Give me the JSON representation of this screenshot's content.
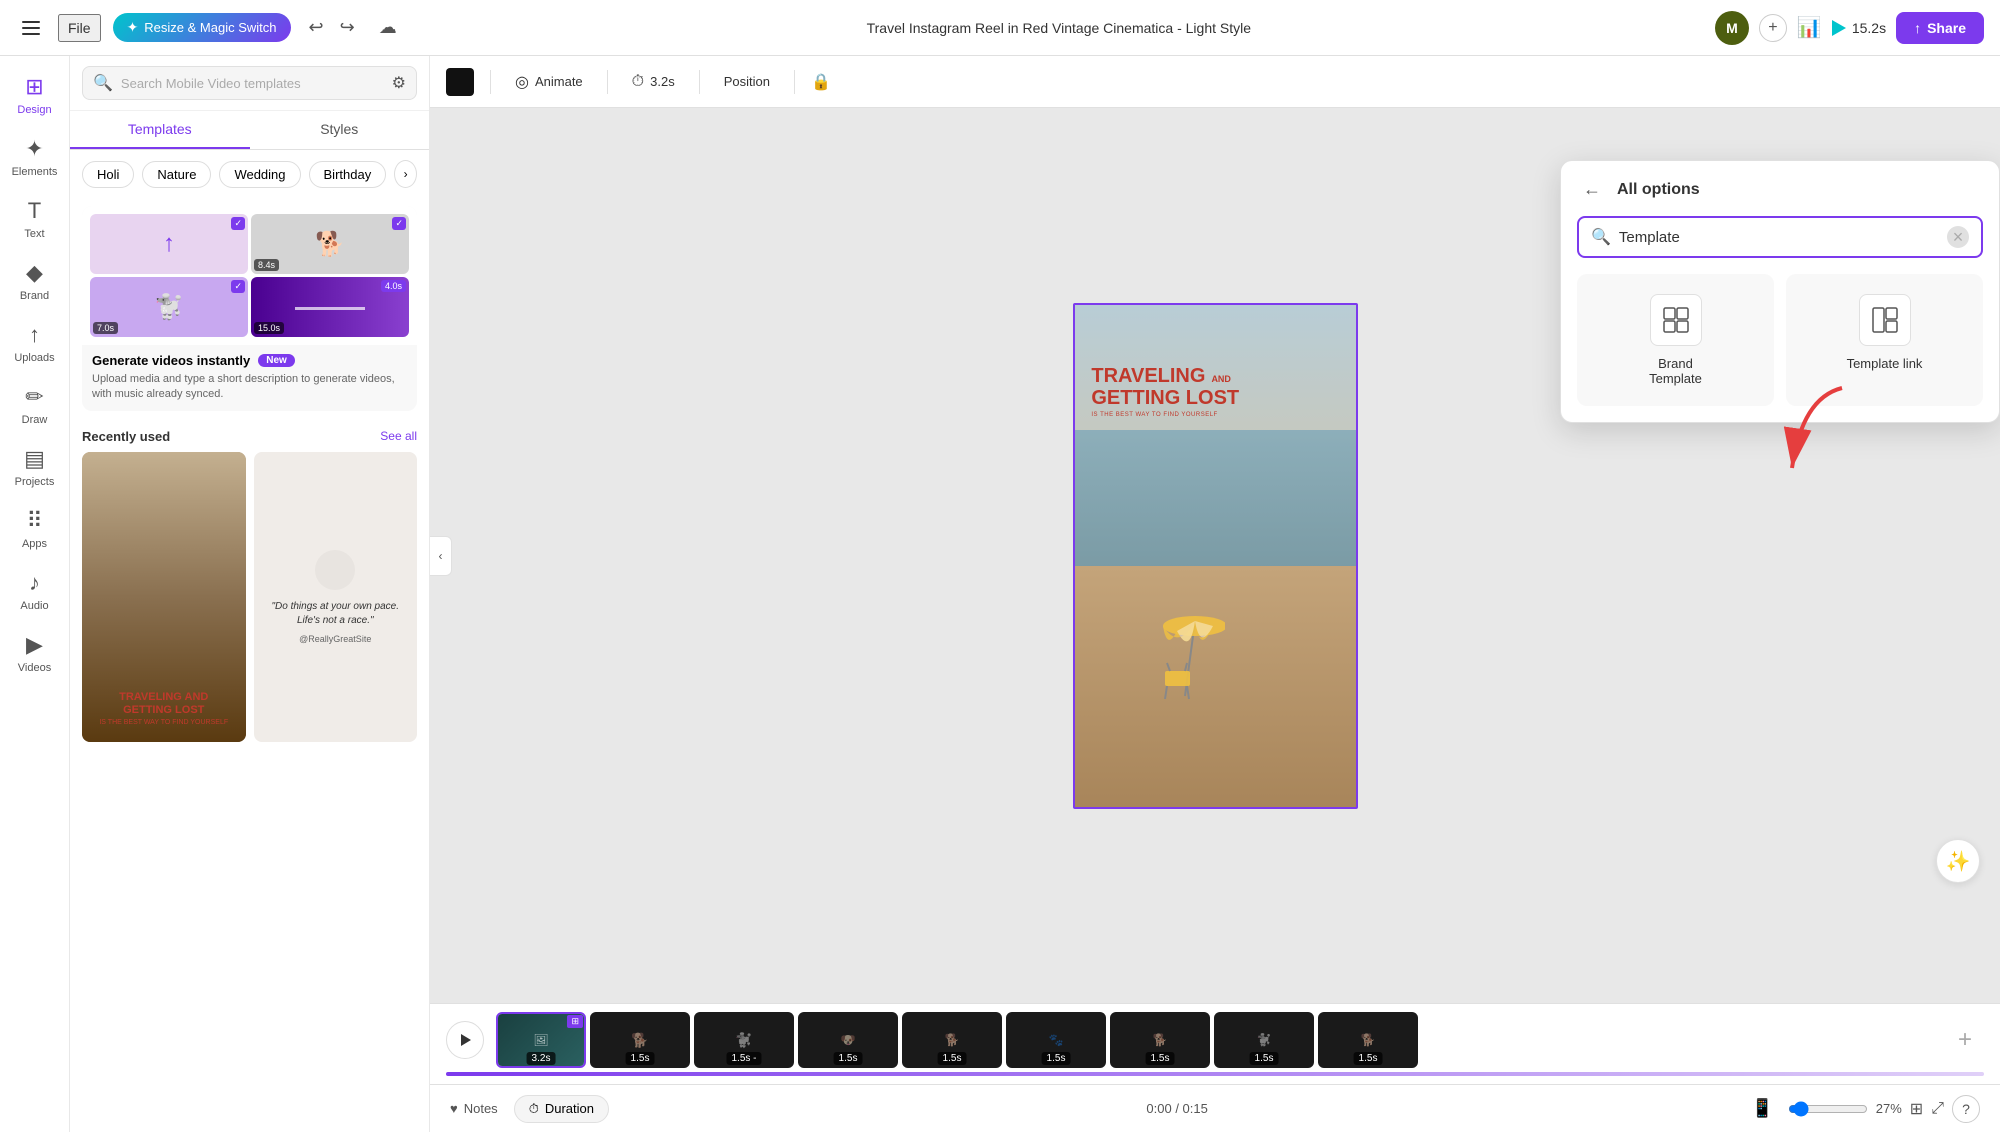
{
  "topbar": {
    "hamburger_label": "Menu",
    "file_label": "File",
    "magic_btn_label": "Resize & Magic Switch",
    "title": "Travel Instagram Reel in Red Vintage Cinematica - Light Style",
    "avatar_initials": "M",
    "preview_time": "15.2s",
    "share_label": "Share"
  },
  "sidebar": {
    "items": [
      {
        "id": "design",
        "label": "Design",
        "icon": "⊞",
        "active": true
      },
      {
        "id": "elements",
        "label": "Elements",
        "icon": "✦"
      },
      {
        "id": "text",
        "label": "Text",
        "icon": "T"
      },
      {
        "id": "brand",
        "label": "Brand",
        "icon": "🔷"
      },
      {
        "id": "uploads",
        "label": "Uploads",
        "icon": "↑"
      },
      {
        "id": "draw",
        "label": "Draw",
        "icon": "✏️"
      },
      {
        "id": "projects",
        "label": "Projects",
        "icon": "📁"
      },
      {
        "id": "apps",
        "label": "Apps",
        "icon": "⋮⋮"
      },
      {
        "id": "audio",
        "label": "Audio",
        "icon": "🎵"
      },
      {
        "id": "videos",
        "label": "Videos",
        "icon": "▶"
      }
    ]
  },
  "panel": {
    "search_placeholder": "Search Mobile Video templates",
    "tabs": [
      "Templates",
      "Styles"
    ],
    "active_tab": "Templates",
    "tags": [
      "Holi",
      "Nature",
      "Wedding",
      "Birthday"
    ],
    "generate_banner": {
      "title": "Generate videos instantly",
      "badge": "New",
      "description": "Upload media and type a short description to generate videos, with music already synced."
    },
    "recently_used": {
      "title": "Recently used",
      "see_all": "See all"
    },
    "template_cards": [
      {
        "id": "card1",
        "title": "TRAVELING AND GETTING LOST",
        "subtitle": "IS THE BEST WAY TO FIND YOURSELF"
      },
      {
        "id": "card2",
        "quote": "\"Do things at your own pace. Life's not a race.\"",
        "handle": "@ReallyGreatSite"
      }
    ]
  },
  "canvas_toolbar": {
    "animate_label": "Animate",
    "time_label": "3.2s",
    "position_label": "Position",
    "lock_icon": "🔒"
  },
  "canvas": {
    "travel_title": "TRAVELING",
    "travel_and": "AND",
    "travel_subtitle": "GETTING LOST",
    "travel_tagline": "IS THE BEST WAY TO FIND YOURSELF"
  },
  "timeline": {
    "clips": [
      {
        "label": "3.2s",
        "active": true
      },
      {
        "label": "1.5s"
      },
      {
        "label": "1.5s -"
      },
      {
        "label": "1.5s"
      },
      {
        "label": "1.5s"
      },
      {
        "label": "1.5s"
      },
      {
        "label": "1.5s"
      },
      {
        "label": "1.5s"
      },
      {
        "label": "1.5s"
      }
    ]
  },
  "bottom_bar": {
    "notes_label": "Notes",
    "duration_label": "Duration",
    "time_counter": "0:00 / 0:15",
    "zoom_pct": "27%"
  },
  "all_options": {
    "title": "All options",
    "search_value": "Template",
    "search_placeholder": "Template",
    "options": [
      {
        "id": "brand-template",
        "label": "Brand Template",
        "icon": "⊞"
      },
      {
        "id": "template-link",
        "label": "Template link",
        "icon": "⊟"
      }
    ]
  }
}
